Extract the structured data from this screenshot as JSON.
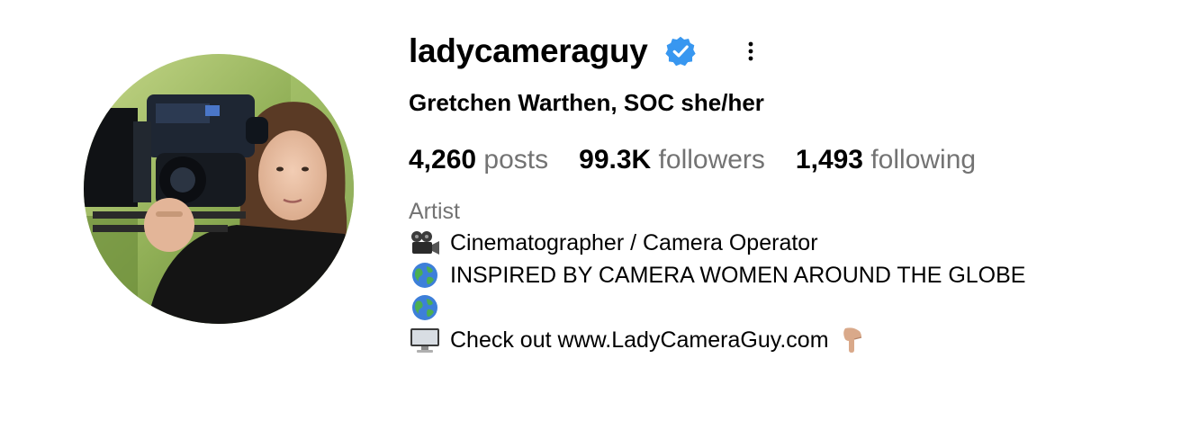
{
  "profile": {
    "username": "ladycameraguy",
    "verified": true,
    "full_name": "Gretchen Warthen, SOC she/her",
    "stats": {
      "posts_count": "4,260",
      "posts_label": "posts",
      "followers_count": "99.3K",
      "followers_label": "followers",
      "following_count": "1,493",
      "following_label": "following"
    },
    "category": "Artist",
    "bio": {
      "line1_icon": "movie-camera-icon",
      "line1_text": "Cinematographer / Camera Operator",
      "line2_icon": "globe-icon",
      "line2_text": "INSPIRED BY CAMERA WOMEN AROUND THE GLOBE",
      "line3_icon": "globe-icon",
      "line4_icon": "desktop-computer-icon",
      "line4_text_prefix": "Check out ",
      "line4_link": "www.LadyCameraGuy.com",
      "line4_trailing_icon": "pointing-down-hand-icon"
    }
  },
  "colors": {
    "verified_badge": "#3897f0",
    "secondary_text": "#737373",
    "primary_text": "#000000"
  }
}
